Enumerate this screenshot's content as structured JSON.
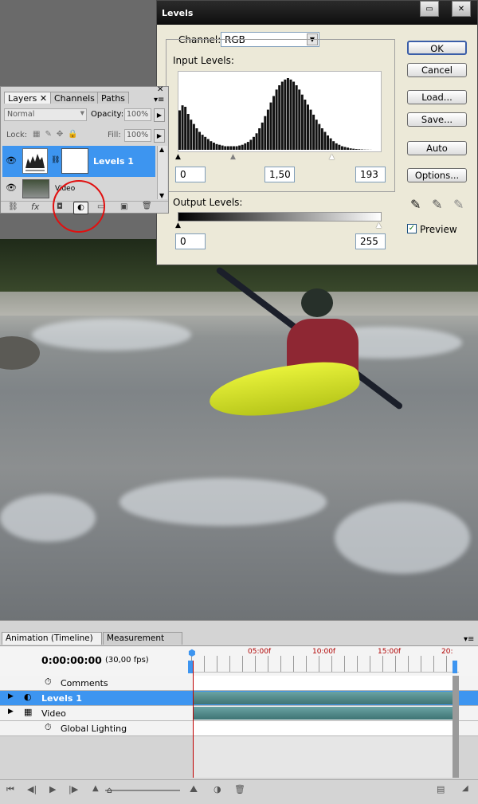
{
  "levels_dialog": {
    "title": "Levels",
    "channel_label": "Channel:",
    "channel_value": "RGB",
    "input_levels_label": "Input Levels:",
    "input_black": "0",
    "input_gamma": "1,50",
    "input_white": "193",
    "output_levels_label": "Output Levels:",
    "output_black": "0",
    "output_white": "255",
    "buttons": {
      "ok": "OK",
      "cancel": "Cancel",
      "load": "Load...",
      "save": "Save...",
      "auto": "Auto",
      "options": "Options..."
    },
    "preview_label": "Preview",
    "preview_checked": true,
    "histogram_bins": [
      0.55,
      0.62,
      0.6,
      0.5,
      0.42,
      0.36,
      0.3,
      0.25,
      0.21,
      0.18,
      0.15,
      0.12,
      0.1,
      0.08,
      0.07,
      0.06,
      0.05,
      0.05,
      0.05,
      0.05,
      0.05,
      0.06,
      0.07,
      0.09,
      0.11,
      0.14,
      0.18,
      0.23,
      0.3,
      0.38,
      0.47,
      0.56,
      0.66,
      0.75,
      0.84,
      0.9,
      0.95,
      0.98,
      1.0,
      0.98,
      0.95,
      0.9,
      0.84,
      0.77,
      0.7,
      0.63,
      0.56,
      0.49,
      0.42,
      0.36,
      0.3,
      0.25,
      0.2,
      0.16,
      0.12,
      0.09,
      0.07,
      0.05,
      0.04,
      0.03,
      0.02,
      0.015,
      0.01,
      0.008,
      0.005,
      0.003,
      0.002,
      0.001,
      0,
      0,
      0
    ]
  },
  "layers_panel": {
    "tabs": [
      "Layers",
      "Channels",
      "Paths"
    ],
    "blend_mode": "Normal",
    "opacity_label": "Opacity:",
    "opacity_value": "100%",
    "lock_label": "Lock:",
    "fill_label": "Fill:",
    "fill_value": "100%",
    "layers": [
      {
        "name": "Levels 1",
        "selected": true
      },
      {
        "name": "Video",
        "selected": false
      }
    ]
  },
  "timeline_panel": {
    "tabs": [
      "Animation (Timeline)",
      "Measurement Log"
    ],
    "timecode": "0:00:00:00",
    "fps": "(30,00 fps)",
    "ruler_ticks": [
      "05:00f",
      "10:00f",
      "15:00f",
      "20:"
    ],
    "rows": [
      {
        "name": "Comments",
        "selected": false
      },
      {
        "name": "Levels 1",
        "selected": true
      },
      {
        "name": "Video",
        "selected": false
      },
      {
        "name": "Global Lighting",
        "selected": false
      }
    ]
  },
  "colors": {
    "selection": "#3d95f0",
    "annotation_circle": "#e01010",
    "playhead": "#c00000",
    "track": "#4f8686"
  }
}
